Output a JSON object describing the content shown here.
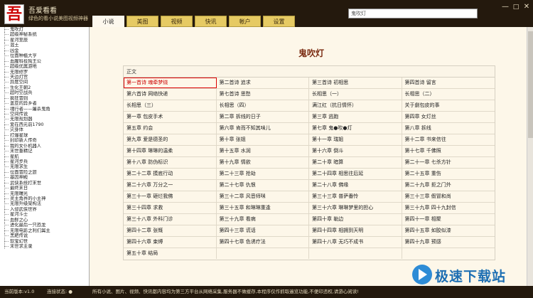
{
  "app": {
    "logo_char": "吾",
    "name": "吾爱看看",
    "tagline": "绿色的看小说美图视频神器"
  },
  "tabs": [
    {
      "label": "小说",
      "active": true
    },
    {
      "label": "美图",
      "active": false
    },
    {
      "label": "视频",
      "active": false
    },
    {
      "label": "快讯",
      "active": false
    },
    {
      "label": "帐户",
      "active": false
    },
    {
      "label": "设置",
      "active": false
    }
  ],
  "search": {
    "value": "鬼吹灯"
  },
  "window": {
    "min": "—",
    "max": "□",
    "close": "✕"
  },
  "sidebar": {
    "items": [
      "鬼吹灯",
      "超级神秘系统",
      "星河至辰",
      "混土",
      "凶金",
      "位面种植大亨",
      "血腥科技狗王公",
      "超级优属游地",
      "无限修罗",
      "天边灯宫",
      "异度空间",
      "生化王朝2",
      "超时空战兵",
      "疯狂冒则",
      "盖亚的异乡者",
      "魂行者——屠杀鬼角",
      "空间传说",
      "无限规划器",
      "爱在西元前1790",
      "灾身体",
      "打爆星球",
      "封印新人传奇",
      "我的女仆机器人",
      "末世重精记",
      "星航",
      "星河步兵",
      "无限求生",
      "位面冒险之旅",
      "基因神殿",
      "武侠系统打末世",
      "最终末日",
      "无限曙光",
      "灵主角界的小主神",
      "无限升级架构法",
      "入侵武侠世界",
      "星河斗士",
      "血鲜之心",
      "进化最后一只恐龙",
      "无限电影之利们翼主",
      "黑耙传说",
      "软宝幻世",
      "末世求主录"
    ]
  },
  "main": {
    "book_title": "鬼吹灯",
    "section": "正文",
    "chapters": [
      [
        "第一首诗 魂牵梦绕",
        "第二首诗 追求",
        "第三首诗 初相思",
        "第四首诗 留言"
      ],
      [
        "第六首诗 网络快递",
        "第七首诗 思愁",
        "长相思（一）",
        "长相思（二）"
      ],
      [
        "长相思（三）",
        "长相思（四）",
        "满江红（抗日情怀）",
        "关于劇包皮的事"
      ],
      [
        "第一章 包皮手术",
        "第二章 拆线的日子",
        "第三章 逃跑",
        "第四章 女灯丝"
      ],
      [
        "第五章 约会",
        "第六章 肯而不知其味儿",
        "第七章 鬼●吹●灯",
        "第八章 拆线"
      ],
      [
        "第九章 爱是德圣的",
        "第十章 张姐",
        "第十一章 瑞姐",
        "第十二章 书来信往"
      ],
      [
        "第十四章 琳琳的温柔",
        "第十五章 水润",
        "第十六章 倒斗",
        "第十七章 千佛照"
      ],
      [
        "第十八章 防伪标识",
        "第十九章 情欲",
        "第二十章 暗算",
        "第二十一章 七杀方针"
      ],
      [
        "第二十二章 摸底行动",
        "第二十三章 抢劫",
        "第二十四章 相思往后延",
        "第二十五章 重伤"
      ],
      [
        "第二十六章 万分之一",
        "第二十七章 仇恨",
        "第二十八章 佛缘",
        "第二十九章 拒之门外"
      ],
      [
        "第三十一章 砸烂我佛",
        "第三十二章 风音师咪",
        "第三十三章 普萨番怜",
        "第三十三章 假冒和尚"
      ],
      [
        "第三十四章 求救",
        "第三十五章 和琳琳重逢",
        "第三十六章 琳琳梦里的担心",
        "第三十九章 四十九封信"
      ],
      [
        "第三十八章 外科门诊",
        "第三十九章 看病",
        "第四十章 勒边",
        "第四十一章 相聚"
      ],
      [
        "第四十二章 张慨",
        "第四十三章 谎话",
        "第四十四章 相拥到天明",
        "第四十五章 如胶似漆"
      ],
      [
        "第四十六章 束缚",
        "第四十七章 色诱疗法",
        "第四十八章 无巧不成书",
        "第四十九章 预感"
      ],
      [
        "第五十章 结局"
      ]
    ],
    "selected": "第一首诗 魂牵梦绕"
  },
  "status": {
    "version": "当前版本:v1.0",
    "connection": "连接状态: ●",
    "notice": "所有小说、图片、视频、快讯都内容均为第三方平台从网络采集,服务器不做缓存,本程序仅作抓取遍览功能,不便印违权,请游心阅读!"
  },
  "watermark": {
    "text": "极速下载站"
  }
}
